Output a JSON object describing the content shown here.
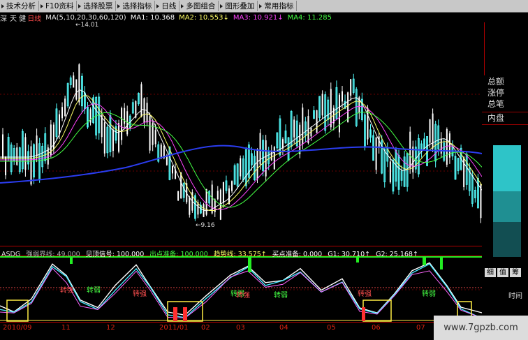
{
  "toolbar": {
    "items": [
      "技术分析",
      "F10资料",
      "选择股票",
      "选择指标",
      "日线",
      "多图组合",
      "图形叠加",
      "常用指标"
    ]
  },
  "header": {
    "stock_code_prefix": "深",
    "stock_name": "天 健",
    "period": "日线",
    "ma_label": "MA(5,10,20,30,60,120)",
    "ma1": "MA1: 10.368",
    "ma2": "MA2: 10.553↓",
    "ma3": "MA3: 10.921↓",
    "ma4": "MA4: 11.285"
  },
  "price_labels": {
    "high": "14.01",
    "low": "9.16"
  },
  "indicator": {
    "name": "ASDG",
    "weak_line": "强弱界线: 49.000",
    "top_signal": "见顶信号: 100.000",
    "exit_prep": "出点准备: 100.000",
    "trend_line": "趋势线: 33.575↑",
    "buy_prep": "买点准备: 0.000",
    "g1": "G1: 30.710↑",
    "g2": "G2: 25.168↑"
  },
  "indicator_marks": [
    "转强",
    "转弱",
    "转强",
    "转弱",
    "转强",
    "转弱",
    "转强",
    "转弱"
  ],
  "x_axis": [
    "2010/09",
    "11",
    "12",
    "2011/01",
    "02",
    "03",
    "04",
    "05",
    "06",
    "07"
  ],
  "right_panel": {
    "labels": [
      "总额",
      "涨停",
      "总笔",
      "内盘"
    ],
    "tabs": [
      "细",
      "值",
      "筹"
    ],
    "time_label": "时间"
  },
  "colors": {
    "background": "#000000",
    "up_candle": "#54ffff",
    "down_candle": "#ffffff",
    "ma_blue": "#2b3df0",
    "accent_red": "#ff3030",
    "signal_green": "#22ee22",
    "signal_yellow": "#ffee44"
  },
  "watermark": "www.7gpzb.com"
}
